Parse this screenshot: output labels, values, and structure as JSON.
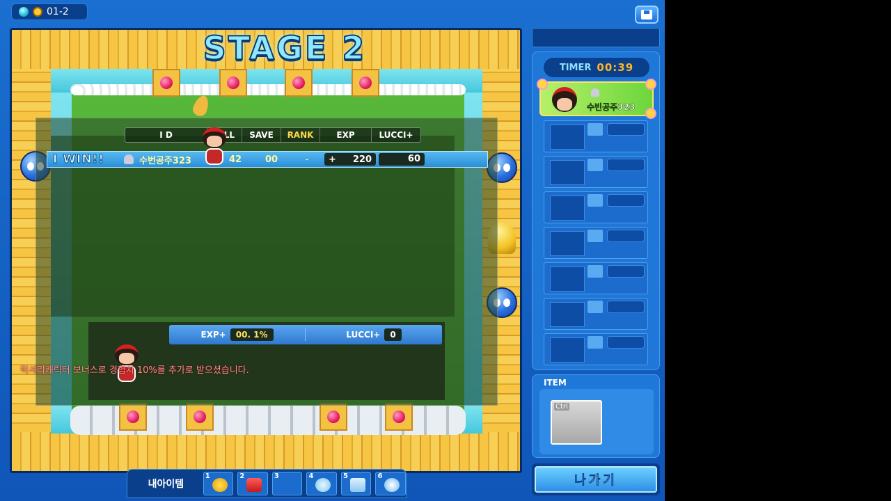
{
  "top": {
    "room_code": "01-2"
  },
  "board": {
    "stage_title": "STAGE 2"
  },
  "results": {
    "columns": [
      "I D",
      "KILL",
      "SAVE",
      "RANK",
      "EXP",
      "LUCCI+"
    ],
    "row": {
      "badge": "I WIN!!",
      "name": "수번공주323",
      "kill": "42",
      "save": "00",
      "rank": "-",
      "exp_sign": "+",
      "exp": "220",
      "lucci": "60"
    },
    "bonus": {
      "exp_label": "EXP+",
      "exp_value": "00. 1%",
      "lucci_label": "LUCCI+",
      "lucci_value": "0"
    },
    "message": "럭셔리캐릭터 보너스로 경험치 10%를 추가로 받으셨습니다."
  },
  "sidebar": {
    "timer_label": "TIMER",
    "timer_value": "00:39",
    "player_name": "수빈공주323",
    "empty_slots": 7,
    "item_title": "ITEM",
    "item_key": "Ctrl",
    "exit_label": "나가기"
  },
  "itembar": {
    "label": "내아이템",
    "slots": [
      "1",
      "2",
      "3",
      "4",
      "5",
      "6"
    ]
  },
  "colors": {
    "accent_blue": "#1f78d8",
    "timer_orange": "#ffb526",
    "rank_yellow": "#ffd84a",
    "message_red": "#ff8c8c"
  }
}
